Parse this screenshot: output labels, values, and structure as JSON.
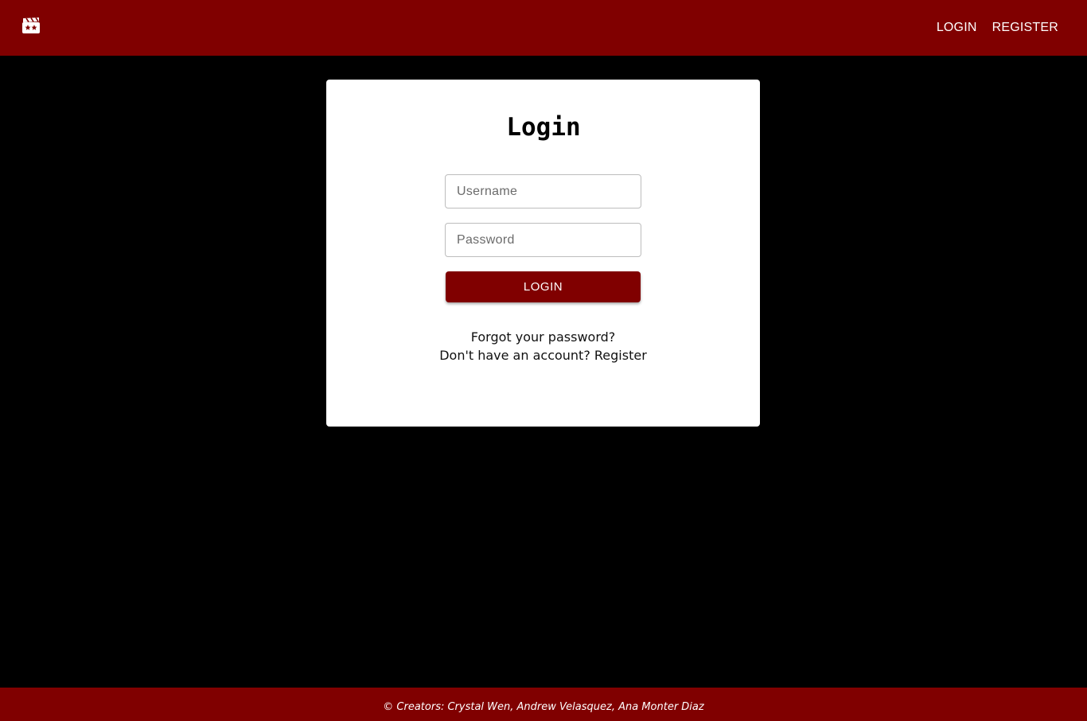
{
  "navbar": {
    "logo_icon": "clapperboard-icon",
    "links": {
      "login": "LOGIN",
      "register": "REGISTER"
    }
  },
  "login_card": {
    "title": "Login",
    "username_placeholder": "Username",
    "password_placeholder": "Password",
    "submit_label": "LOGIN",
    "forgot_password": "Forgot your password?",
    "no_account_prefix": "Don't have an account? ",
    "register_link": "Register"
  },
  "footer": {
    "text": "© Creators: Crystal Wen, Andrew Velasquez, Ana Monter Diaz"
  },
  "colors": {
    "brand": "#800000",
    "background": "#000000",
    "card": "#ffffff"
  }
}
